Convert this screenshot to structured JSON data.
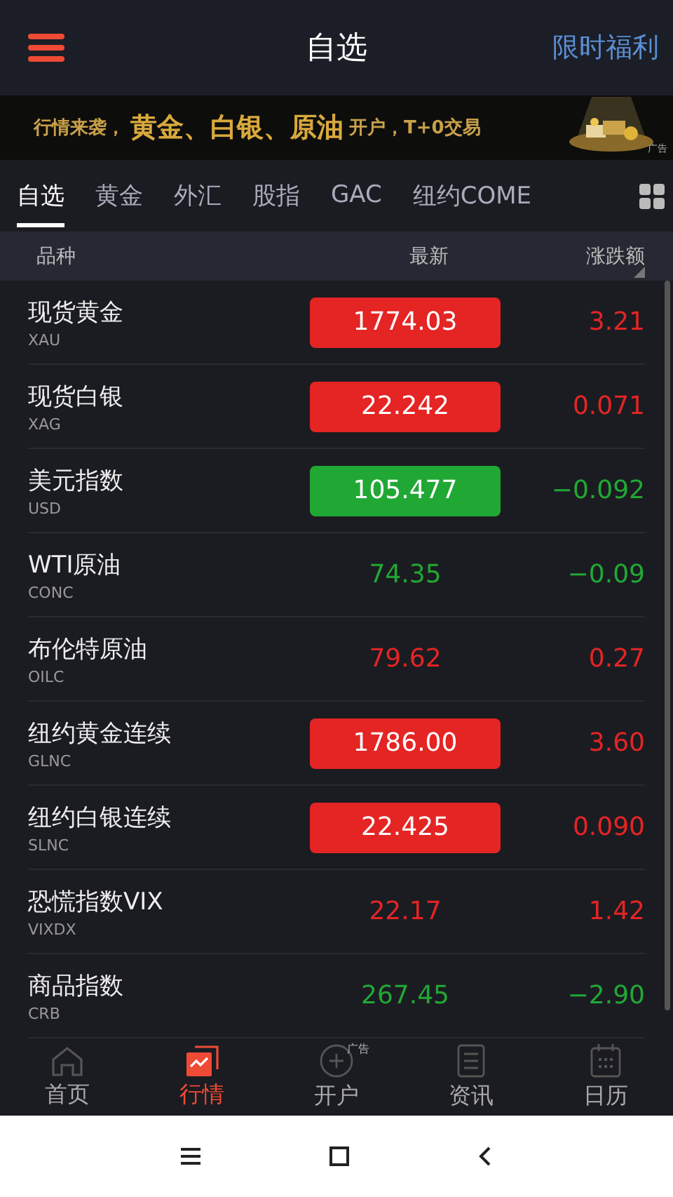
{
  "header": {
    "title": "自选",
    "action": "限时福利"
  },
  "banner": {
    "lead": "行情来袭，",
    "highlight": "黄金、白银、原油",
    "tail": "开户，T+0交易",
    "ad_tag": "广告"
  },
  "tabs": [
    {
      "label": "自选",
      "selected": true
    },
    {
      "label": "黄金",
      "selected": false
    },
    {
      "label": "外汇",
      "selected": false
    },
    {
      "label": "股指",
      "selected": false
    },
    {
      "label": "GAC",
      "selected": false
    },
    {
      "label": "纽约COME",
      "selected": false
    }
  ],
  "table": {
    "columns": [
      "品种",
      "最新",
      "涨跌额"
    ],
    "rows": [
      {
        "name": "现货黄金",
        "code": "XAU",
        "price": "1774.03",
        "change": "3.21",
        "rising": true,
        "boxed": true
      },
      {
        "name": "现货白银",
        "code": "XAG",
        "price": "22.242",
        "change": "0.071",
        "rising": true,
        "boxed": true
      },
      {
        "name": "美元指数",
        "code": "USD",
        "price": "105.477",
        "change": "−0.092",
        "rising": false,
        "boxed": true
      },
      {
        "name": "WTI原油",
        "code": "CONC",
        "price": "74.35",
        "change": "−0.09",
        "rising": false,
        "boxed": false
      },
      {
        "name": "布伦特原油",
        "code": "OILC",
        "price": "79.62",
        "change": "0.27",
        "rising": true,
        "boxed": false
      },
      {
        "name": "纽约黄金连续",
        "code": "GLNC",
        "price": "1786.00",
        "change": "3.60",
        "rising": true,
        "boxed": true
      },
      {
        "name": "纽约白银连续",
        "code": "SLNC",
        "price": "22.425",
        "change": "0.090",
        "rising": true,
        "boxed": true
      },
      {
        "name": "恐慌指数VIX",
        "code": "VIXDX",
        "price": "22.17",
        "change": "1.42",
        "rising": true,
        "boxed": false
      },
      {
        "name": "商品指数",
        "code": "CRB",
        "price": "267.45",
        "change": "−2.90",
        "rising": false,
        "boxed": false
      }
    ]
  },
  "nav": [
    {
      "label": "首页",
      "kind": "home",
      "selected": false
    },
    {
      "label": "行情",
      "kind": "market",
      "selected": true
    },
    {
      "label": "开户",
      "kind": "open",
      "selected": false,
      "badge": "广告"
    },
    {
      "label": "资讯",
      "kind": "news",
      "selected": false
    },
    {
      "label": "日历",
      "kind": "calendar",
      "selected": false
    }
  ]
}
